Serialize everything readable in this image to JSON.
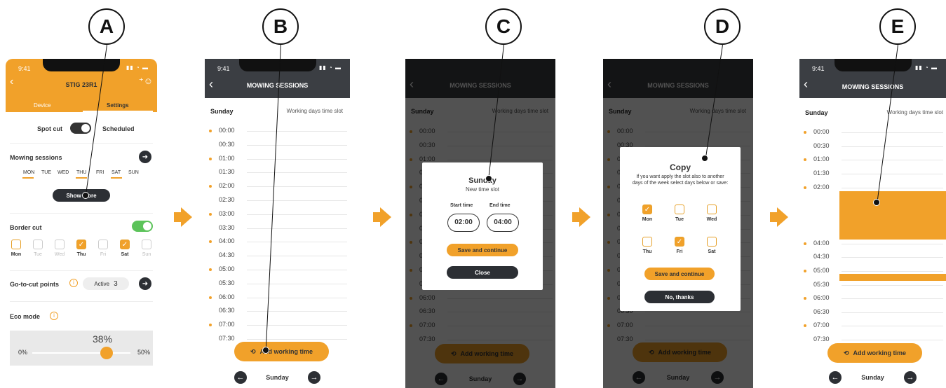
{
  "markers": [
    "A",
    "B",
    "C",
    "D",
    "E"
  ],
  "status_time": "9:41",
  "colors": {
    "accent": "#f1a12a",
    "dark": "#3b3e43",
    "green": "#5cc35a"
  },
  "screenA": {
    "title": "STIG 23R1",
    "tabs": [
      "Device",
      "Settings"
    ],
    "spot_cut": "Spot cut",
    "scheduled": "Scheduled",
    "mowing_sessions": "Mowing sessions",
    "days": [
      "MON",
      "TUE",
      "WED",
      "THU",
      "FRI",
      "SAT",
      "SUN"
    ],
    "show_more": "Show more",
    "border_cut": "Border cut",
    "border_days": [
      "Mon",
      "Tue",
      "Wed",
      "Thu",
      "Fri",
      "Sat",
      "Sun"
    ],
    "go_to_cut": "Go-to-cut points",
    "active": "Active",
    "active_count": "3",
    "eco_mode": "Eco mode",
    "slider_value": "38%",
    "slider_min": "0%",
    "slider_max": "50%",
    "slider_level": 0.76
  },
  "sessions": {
    "title": "MOWING SESSIONS",
    "day": "Sunday",
    "working": "Working days time slot",
    "times": [
      "00:00",
      "00:30",
      "01:00",
      "01:30",
      "02:00",
      "02:30",
      "03:00",
      "03:30",
      "04:00",
      "04:30",
      "05:00",
      "05:30",
      "06:00",
      "06:30",
      "07:00",
      "07:30"
    ],
    "add": "Add working time",
    "nav_day": "Sunday"
  },
  "screenC": {
    "title": "Sunday",
    "subtitle": "New time slot",
    "start_label": "Start time",
    "end_label": "End time",
    "start": "02:00",
    "end": "04:00",
    "save": "Save and continue",
    "close": "Close"
  },
  "screenD": {
    "title": "Copy",
    "text": "If you want apply the slot also to another days of the week select days below or save:",
    "days": [
      "Mon",
      "Tue",
      "Wed",
      "Thu",
      "Fri",
      "Sat"
    ],
    "save": "Save and continue",
    "no": "No, thanks"
  },
  "screenE": {
    "times": [
      "00:00",
      "00:30",
      "01:00",
      "01:30",
      "02:00",
      "04:00",
      "04:30",
      "05:00",
      "05:30",
      "06:00",
      "06:30",
      "07:00",
      "07:30"
    ]
  }
}
